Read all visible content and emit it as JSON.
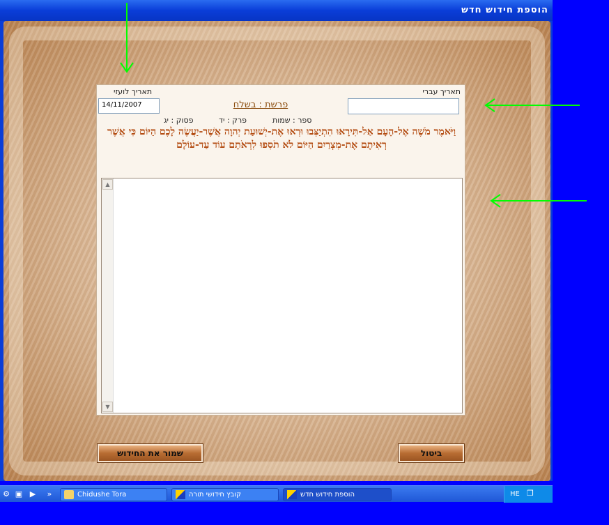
{
  "window": {
    "title": "הוספת חידוש חדש"
  },
  "form": {
    "hebrew_date_label": "תאריך עברי",
    "hebrew_date_value": "",
    "gregorian_date_label": "תאריך לועזי",
    "gregorian_date_value": "14/11/2007",
    "parsha": "פרשת : בשלח",
    "sefer": "ספר : שמות",
    "perek": "פרק : יד",
    "pasuk": "פסוק : יג",
    "verse": "וַיֹּאמֶר מֹשֶׁה אֶל-הָעָם אַל-תִּירָאוּ הִתְיַצְּבוּ וּרְאוּ אֶת-יְשׁוּעַת יְהוָה אֲשֶׁר-יַעֲשֶׂה לָכֶם הַיּוֹם כִּי אֲשֶׁר רְאִיתֶם אֶת-מִצְרַיִם הַיּוֹם לֹא תֹסִפוּ לִרְאֹתָם עוֹד עַד-עוֹלָם",
    "chiddush_text": ""
  },
  "buttons": {
    "save": "שמור את החידוש",
    "cancel": "ביטול"
  },
  "taskbar": {
    "tasks": [
      {
        "label": "Chidushe Tora",
        "icon": "folder-icon"
      },
      {
        "label": "קובץ חידושי תורה",
        "icon": "app-icon"
      },
      {
        "label": "הוספת חידוש חדש",
        "icon": "app-icon"
      }
    ],
    "tray": {
      "lang": "HE"
    }
  },
  "colors": {
    "arrow": "#00ff00",
    "verse": "#b2490e",
    "titlebar": "#0a3dd8"
  }
}
